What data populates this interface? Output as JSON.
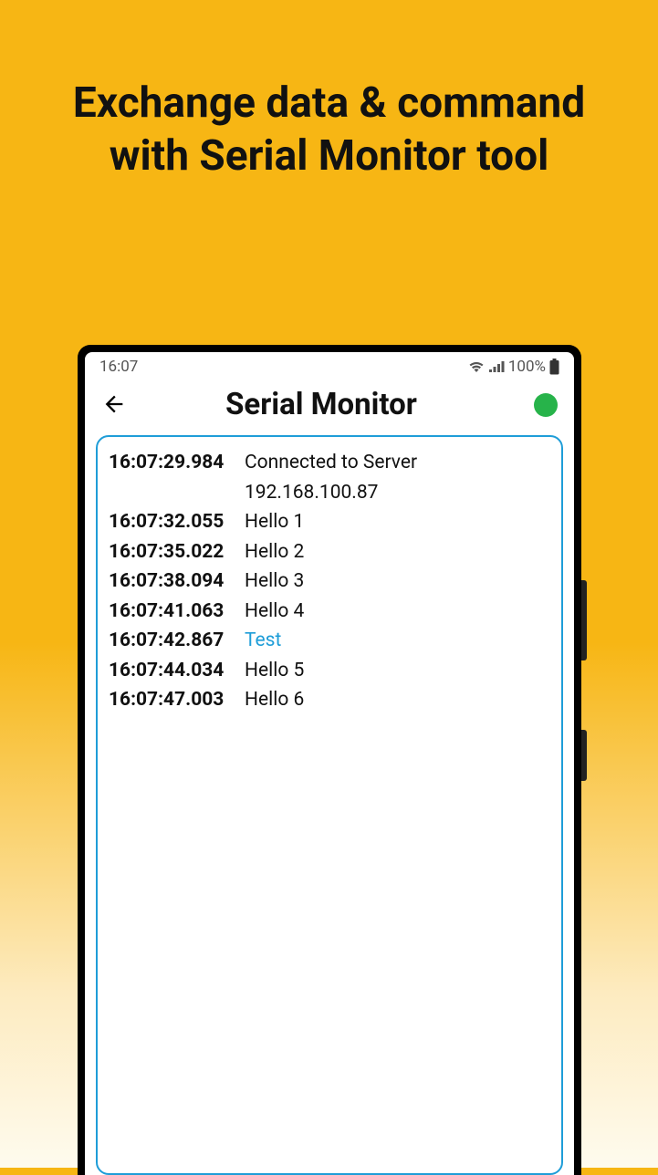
{
  "promo": {
    "heading": "Exchange data & command with Serial Monitor tool"
  },
  "status_bar": {
    "time": "16:07",
    "battery_text": "100%"
  },
  "app_bar": {
    "title": "Serial Monitor"
  },
  "log": [
    {
      "time": "16:07:29.984",
      "message": "Connected to Server 192.168.100.87",
      "special": false
    },
    {
      "time": "16:07:32.055",
      "message": "Hello 1",
      "special": false
    },
    {
      "time": "16:07:35.022",
      "message": "Hello 2",
      "special": false
    },
    {
      "time": "16:07:38.094",
      "message": "Hello 3",
      "special": false
    },
    {
      "time": "16:07:41.063",
      "message": "Hello 4",
      "special": false
    },
    {
      "time": "16:07:42.867",
      "message": "Test",
      "special": true
    },
    {
      "time": "16:07:44.034",
      "message": "Hello 5",
      "special": false
    },
    {
      "time": "16:07:47.003",
      "message": "Hello 6",
      "special": false
    }
  ]
}
